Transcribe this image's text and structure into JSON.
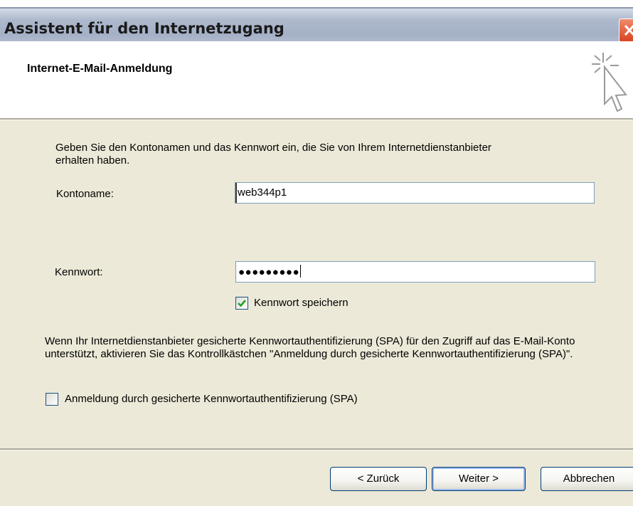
{
  "window": {
    "title": "Assistent für den Internetzugang"
  },
  "header": {
    "heading": "Internet-E-Mail-Anmeldung",
    "icon": "wizard-cursor-icon"
  },
  "form": {
    "intro": "Geben Sie den Kontonamen und das Kennwort ein, die Sie von Ihrem Internetdienstanbieter erhalten haben.",
    "account_label": "Kontoname:",
    "account_value": "web344p1",
    "password_label": "Kennwort:",
    "password_value": "●●●●●●●●●",
    "save_password_label": "Kennwort speichern",
    "save_password_checked": true,
    "spa_text": "Wenn Ihr Internetdienstanbieter gesicherte Kennwortauthentifizierung (SPA) für den Zugriff auf das E-Mail-Konto unterstützt, aktivieren Sie das Kontrollkästchen \"Anmeldung durch gesicherte Kennwortauthentifizierung (SPA)\".",
    "spa_label": "Anmeldung durch gesicherte Kennwortauthentifizierung (SPA)",
    "spa_checked": false
  },
  "buttons": {
    "back": "< Zurück",
    "next": "Weiter >",
    "cancel": "Abbrechen"
  },
  "colors": {
    "dialog_bg": "#ece9d8",
    "close_button": "#d8421e",
    "checkmark": "#21a121"
  }
}
